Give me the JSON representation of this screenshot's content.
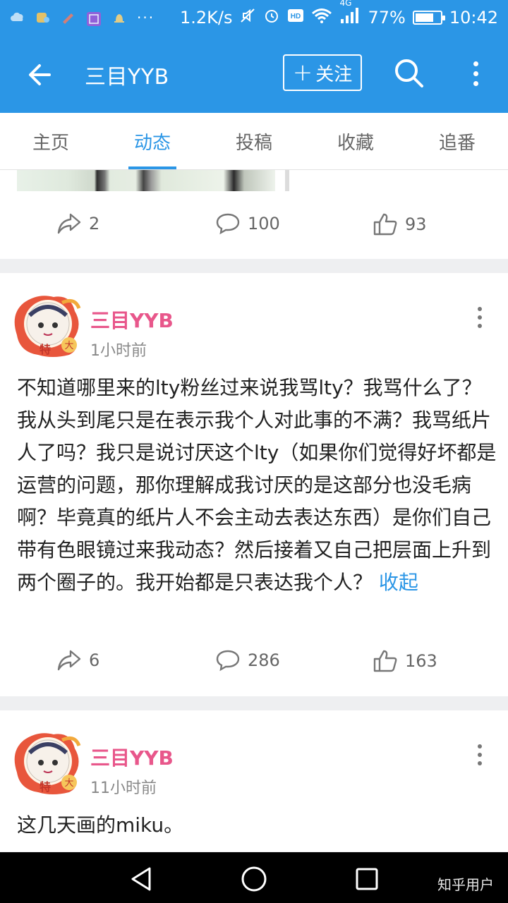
{
  "status_bar": {
    "speed": "1.2K/s",
    "network_type": "4G",
    "battery_percent": "77%",
    "battery_level": 0.77,
    "time": "10:42",
    "icons": [
      "cloud-icon",
      "app-icon",
      "pen-icon",
      "photo-icon",
      "bell-icon",
      "more-dots-icon",
      "mute-icon",
      "alarm-icon",
      "hd-icon",
      "wifi-icon",
      "signal-icon",
      "battery-icon"
    ]
  },
  "app_bar": {
    "title": "三目YYB",
    "follow_label": "关注",
    "follow_plus": "+"
  },
  "tabs": [
    {
      "label": "主页",
      "active": false
    },
    {
      "label": "动态",
      "active": true
    },
    {
      "label": "投稿",
      "active": false
    },
    {
      "label": "收藏",
      "active": false
    },
    {
      "label": "追番",
      "active": false
    }
  ],
  "posts": [
    {
      "shares": "2",
      "comments": "100",
      "likes": "93"
    },
    {
      "author": "三目YYB",
      "time": "1小时前",
      "text": "不知道哪里来的lty粉丝过来说我骂lty？我骂什么了？我从头到尾只是在表示我个人对此事的不满？我骂纸片人了吗？我只是说讨厌这个lty（如果你们觉得好坏都是运营的问题，那你理解成我讨厌的是这部分也没毛病啊？毕竟真的纸片人不会主动去表达东西）是你们自己带有色眼镜过来我动态？然后接着又自己把层面上升到两个圈子的。我开始都是只表达我个人？",
      "collapse_label": "收起",
      "shares": "6",
      "comments": "286",
      "likes": "163"
    },
    {
      "author": "三目YYB",
      "time": "11小时前",
      "text": "这几天画的miku。"
    }
  ],
  "colors": {
    "primary": "#2b96e6",
    "author": "#e8578b"
  },
  "watermark": "知乎用户"
}
